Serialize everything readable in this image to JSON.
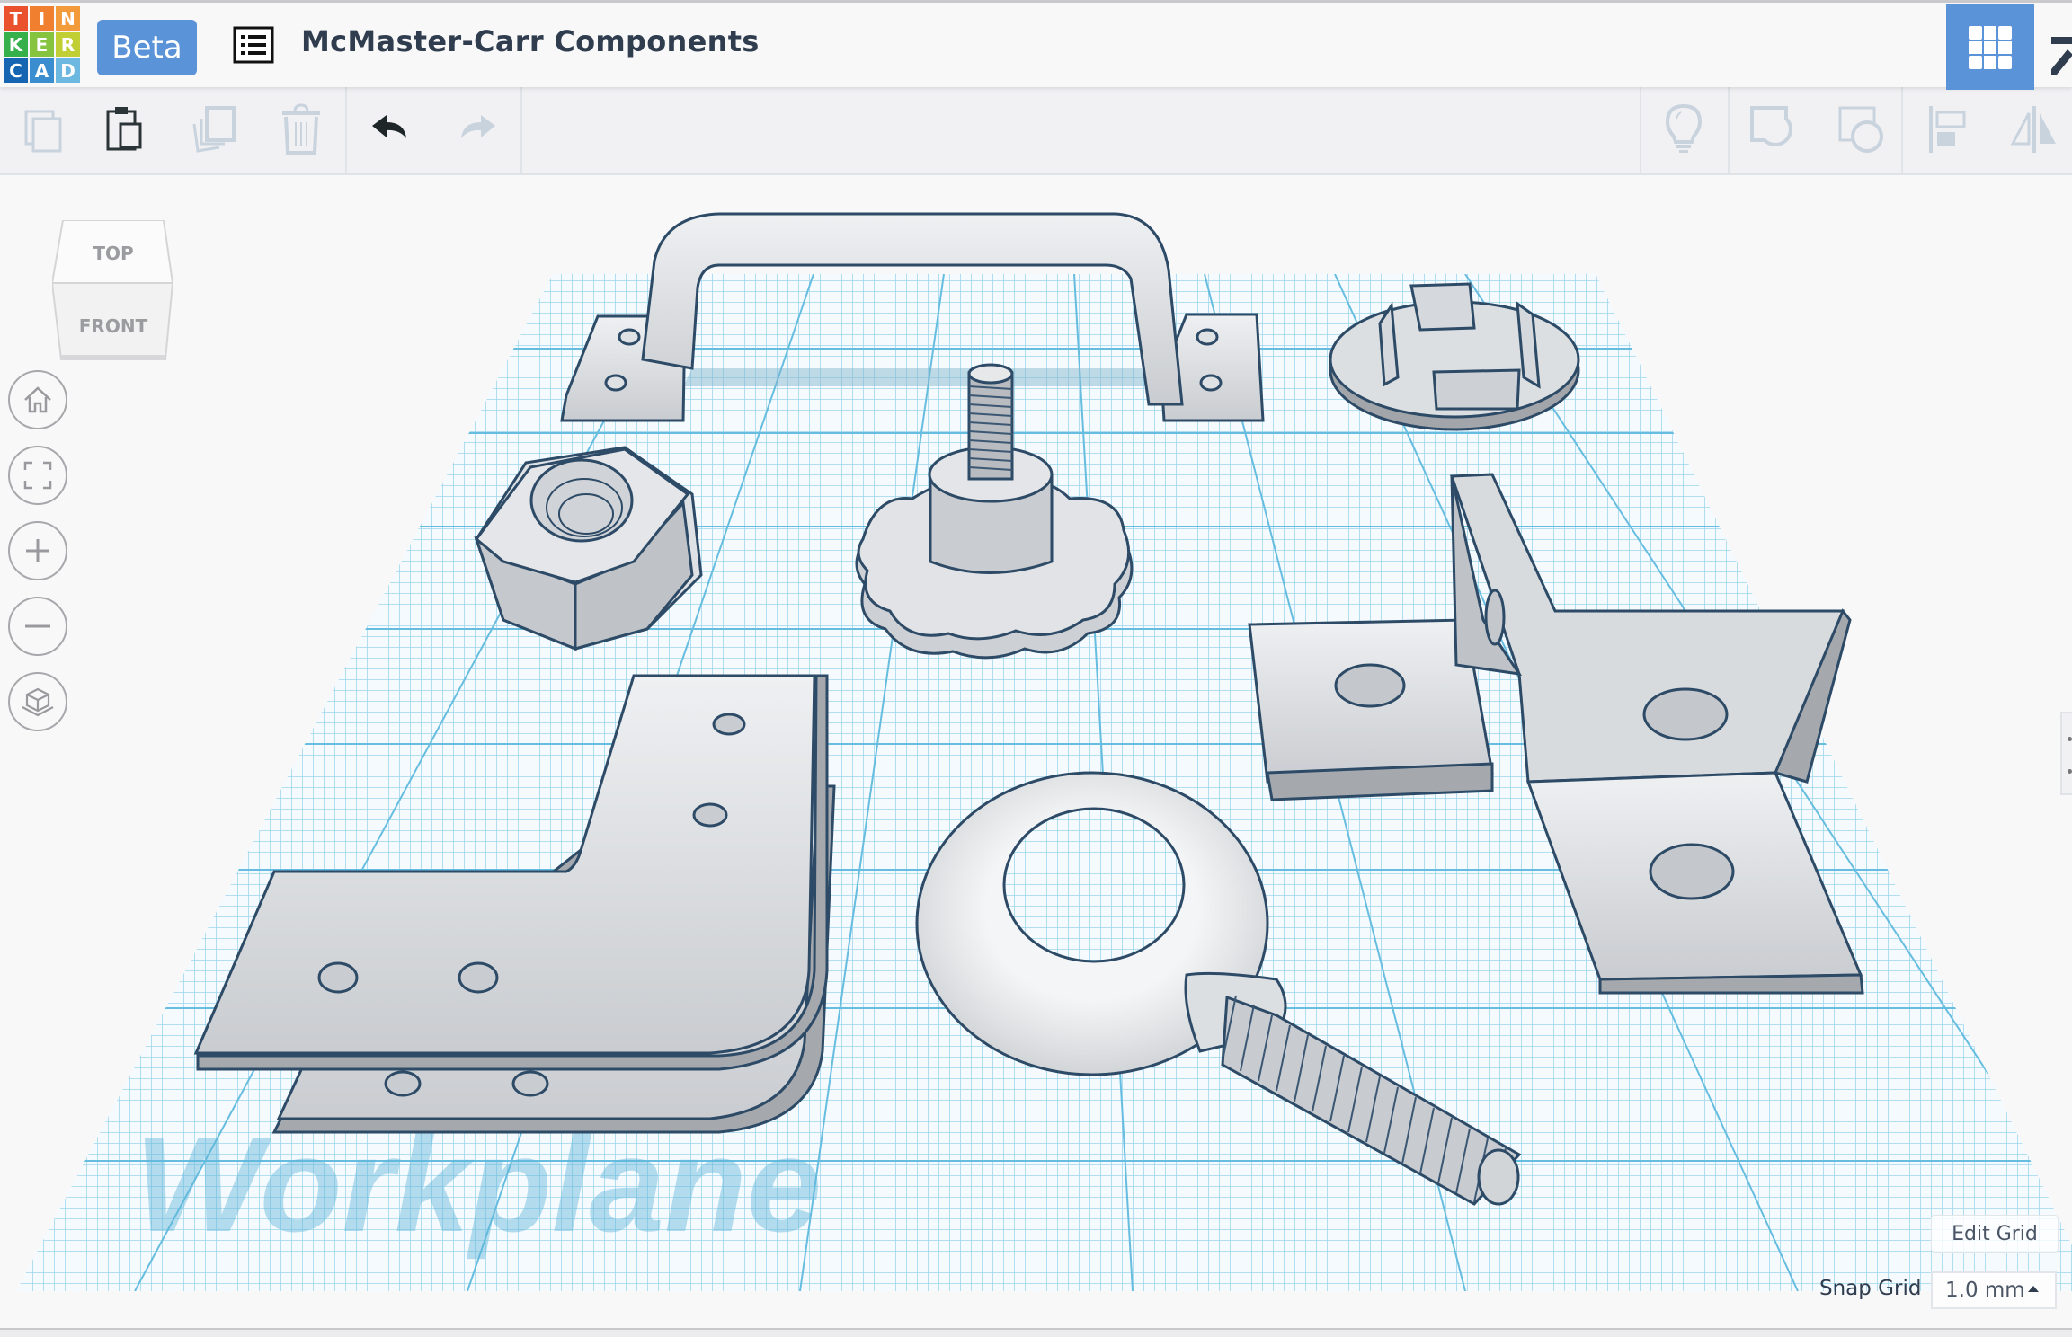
{
  "app": {
    "logo_letters": [
      "T",
      "I",
      "N",
      "K",
      "E",
      "R",
      "C",
      "A",
      "D"
    ],
    "logo_colors": [
      "#e9522c",
      "#f07f30",
      "#f39a3a",
      "#36b04b",
      "#86c440",
      "#c2cf34",
      "#1565b2",
      "#3a8ed0",
      "#6db8e1"
    ],
    "beta_label": "Beta",
    "design_title": "McMaster-Carr Components",
    "accent_color": "#5b93d8"
  },
  "header": {
    "design_list_icon": "list-icon",
    "active_view_button": "grid-view-icon",
    "edge_button_icon": "edit-pencil-icon"
  },
  "toolbar": {
    "left": [
      {
        "name": "copy",
        "icon": "copy-icon",
        "enabled": false
      },
      {
        "name": "paste",
        "icon": "paste-icon",
        "enabled": true
      },
      {
        "name": "duplicate",
        "icon": "duplicate-icon",
        "enabled": false
      },
      {
        "name": "delete",
        "icon": "trash-icon",
        "enabled": false
      },
      {
        "name": "undo",
        "icon": "undo-icon",
        "enabled": true
      },
      {
        "name": "redo",
        "icon": "redo-icon",
        "enabled": false
      }
    ],
    "right": [
      {
        "name": "show-hide",
        "icon": "lightbulb-icon",
        "enabled": false
      },
      {
        "name": "group",
        "icon": "group-icon",
        "enabled": false
      },
      {
        "name": "ungroup",
        "icon": "ungroup-icon",
        "enabled": false
      },
      {
        "name": "align",
        "icon": "align-icon",
        "enabled": false
      },
      {
        "name": "mirror",
        "icon": "mirror-icon",
        "enabled": false
      }
    ]
  },
  "viewcube": {
    "top_label": "TOP",
    "front_label": "FRONT"
  },
  "nav_controls": [
    {
      "name": "home-view",
      "icon": "home-icon"
    },
    {
      "name": "fit-all",
      "icon": "fit-view-icon"
    },
    {
      "name": "zoom-in",
      "icon": "plus-icon"
    },
    {
      "name": "zoom-out",
      "icon": "minus-icon"
    },
    {
      "name": "perspective",
      "icon": "ortho-cube-icon"
    }
  ],
  "workplane": {
    "watermark": "Workplane",
    "objects": [
      "handle",
      "round-cap",
      "hex-nut",
      "threaded-knob",
      "corner-bracket",
      "flat-corner-plate",
      "eye-bolt",
      "angle-bracket"
    ]
  },
  "grid_controls": {
    "edit_grid_label": "Edit Grid",
    "snap_grid_label": "Snap Grid",
    "snap_grid_value": "1.0 mm"
  }
}
